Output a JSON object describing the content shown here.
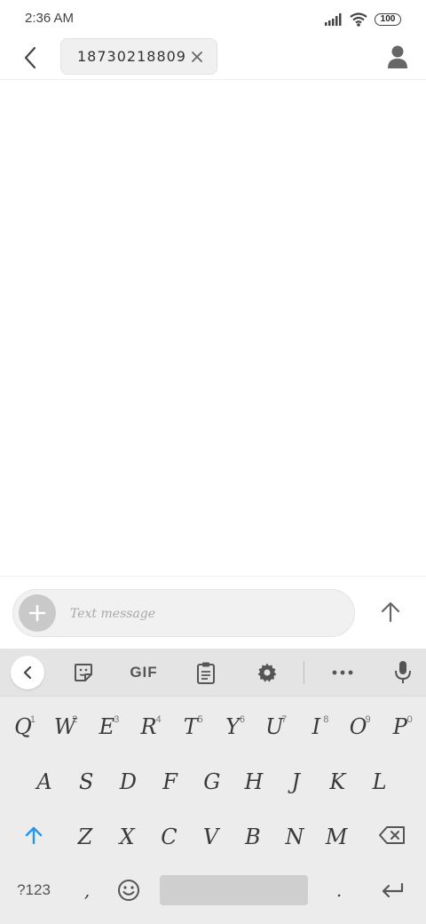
{
  "status_bar": {
    "time": "2:36 AM",
    "battery_level": "100",
    "icons": [
      "signal-icon",
      "wifi-icon",
      "battery-icon"
    ]
  },
  "header": {
    "recipient": "18730218809",
    "icons": [
      "back-arrow-icon",
      "close-icon",
      "contact-person-icon"
    ]
  },
  "composer": {
    "placeholder": "Text message",
    "value": "",
    "icons": [
      "plus-icon",
      "send-arrow-icon"
    ]
  },
  "keyboard": {
    "toolbar": {
      "gif_label": "GIF",
      "icons": [
        "chevron-left-icon",
        "sticker-icon",
        "clipboard-icon",
        "gear-icon",
        "more-dots-icon",
        "microphone-icon"
      ]
    },
    "row1": [
      {
        "key": "Q",
        "hint": "1"
      },
      {
        "key": "W",
        "hint": "2"
      },
      {
        "key": "E",
        "hint": "3"
      },
      {
        "key": "R",
        "hint": "4"
      },
      {
        "key": "T",
        "hint": "5"
      },
      {
        "key": "Y",
        "hint": "6"
      },
      {
        "key": "U",
        "hint": "7"
      },
      {
        "key": "I",
        "hint": "8"
      },
      {
        "key": "O",
        "hint": "9"
      },
      {
        "key": "P",
        "hint": "0"
      }
    ],
    "row2": [
      "A",
      "S",
      "D",
      "F",
      "G",
      "H",
      "J",
      "K",
      "L"
    ],
    "row3": [
      "Z",
      "X",
      "C",
      "V",
      "B",
      "N",
      "M"
    ],
    "symbols_label": "?123",
    "comma": ",",
    "period": ".",
    "accent_color": "#2196f3"
  }
}
